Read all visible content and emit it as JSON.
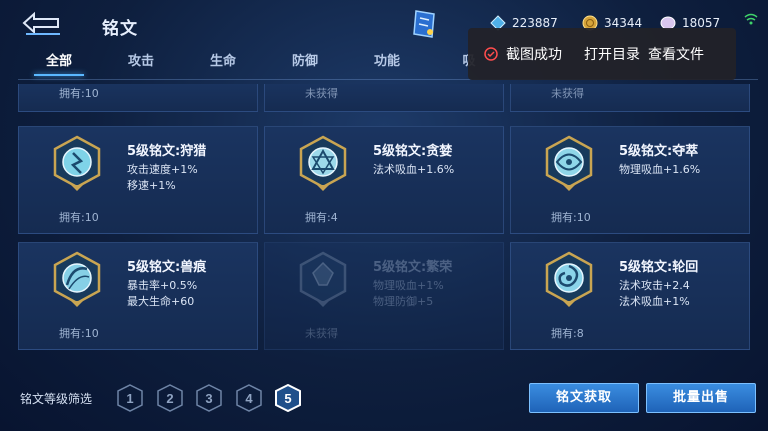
{
  "header": {
    "title": "铭文",
    "currency": [
      {
        "icon": "diamond-icon",
        "value": "223887"
      },
      {
        "icon": "gold-coin-icon",
        "value": "34344"
      },
      {
        "icon": "gem-icon",
        "value": "18057"
      }
    ]
  },
  "tabs": [
    "全部",
    "攻击",
    "生命",
    "防御",
    "功能",
    "吸"
  ],
  "top_row": [
    {
      "status": "拥有:10"
    },
    {
      "status": "未获得"
    },
    {
      "status": "未获得"
    }
  ],
  "runes": [
    {
      "name": "5级铭文:狩猎",
      "stats": [
        "攻击速度+1%",
        "移速+1%"
      ],
      "status": "拥有:10",
      "owned": true
    },
    {
      "name": "5级铭文:贪婪",
      "stats": [
        "法术吸血+1.6%"
      ],
      "status": "拥有:4",
      "owned": true
    },
    {
      "name": "5级铭文:夺萃",
      "stats": [
        "物理吸血+1.6%"
      ],
      "status": "拥有:10",
      "owned": true
    },
    {
      "name": "5级铭文:兽痕",
      "stats": [
        "暴击率+0.5%",
        "最大生命+60"
      ],
      "status": "拥有:10",
      "owned": true
    },
    {
      "name": "5级铭文:繁荣",
      "stats": [
        "物理吸血+1%",
        "物理防御+5"
      ],
      "status": "未获得",
      "owned": false
    },
    {
      "name": "5级铭文:轮回",
      "stats": [
        "法术攻击+2.4",
        "法术吸血+1%"
      ],
      "status": "拥有:8",
      "owned": true
    }
  ],
  "filter": {
    "label": "铭文等级筛选",
    "levels": [
      "1",
      "2",
      "3",
      "4",
      "5"
    ],
    "selected": "5"
  },
  "buttons": {
    "obtain": "铭文获取",
    "bulk_sell": "批量出售"
  },
  "toast": {
    "message": "截图成功",
    "open_dir": "打开目录",
    "view_file": "查看文件"
  },
  "colors": {
    "accent": "#5ab8ff",
    "button": "#2f7fd6",
    "rune_gold": "#c9a552",
    "rune_teal": "#7fd3e8"
  }
}
